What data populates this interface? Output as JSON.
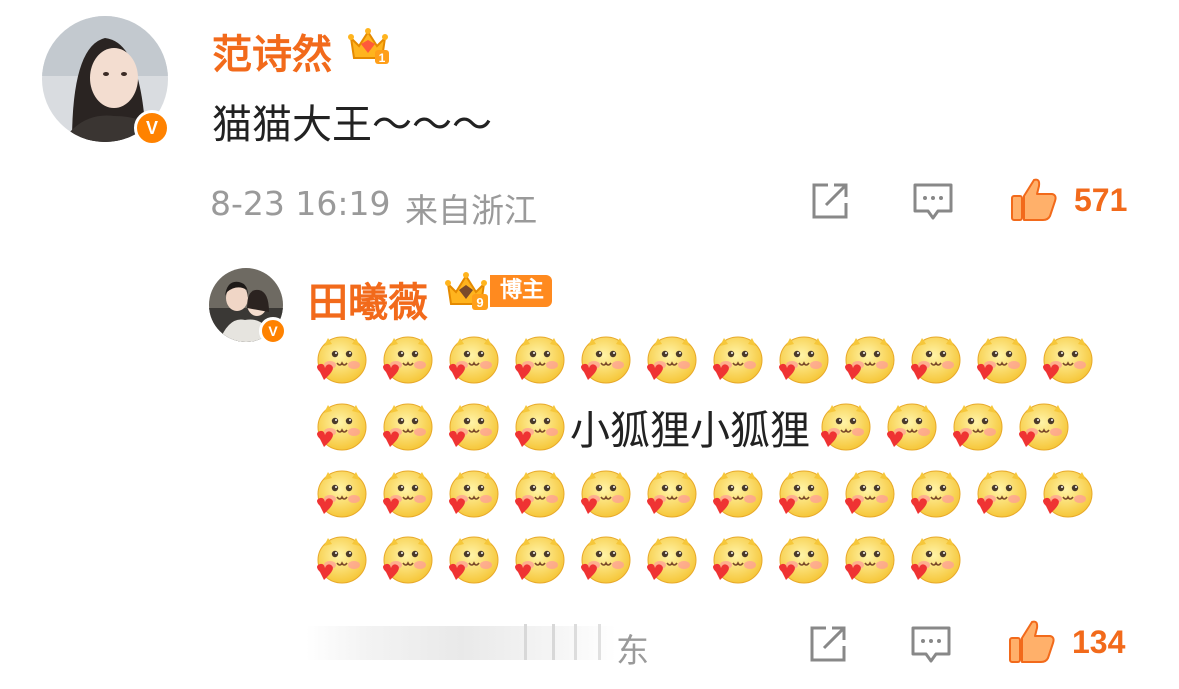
{
  "comment": {
    "username": "范诗然",
    "text": "猫猫大王～～～",
    "date": "8-23 16:19",
    "location": "来自浙江",
    "likes": "571",
    "verified_badge": "V",
    "crown_icon": "crown-level-1-icon"
  },
  "reply": {
    "username": "田曦薇",
    "host_tag": "博主",
    "verified_badge": "V",
    "crown_icon": "crown-level-9-icon",
    "inline_text": "小狐狸小狐狸",
    "emoji_name": "blushing-heart-emoji",
    "emoji_rows": {
      "row1_count": 12,
      "row2_before_text": 4,
      "row2_after_text": 4,
      "row3_count": 12,
      "row4_count": 10
    },
    "footer_text": "东",
    "likes": "134"
  },
  "colors": {
    "accent": "#f26a1b",
    "meta": "#9a9a9a",
    "verified": "#ff8200"
  }
}
